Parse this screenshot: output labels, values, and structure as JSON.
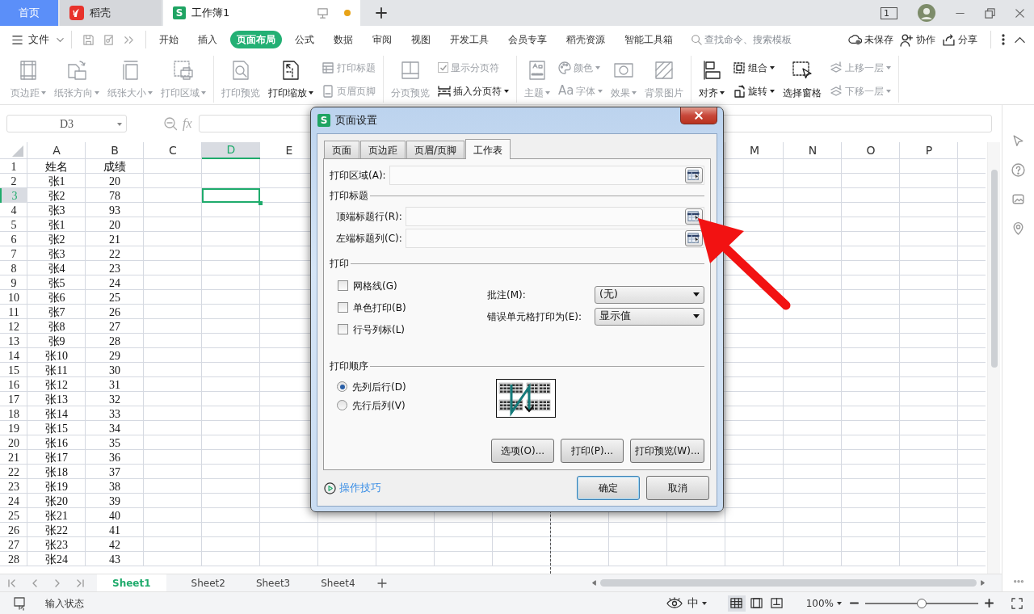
{
  "top_tabs": [
    {
      "kind": "home",
      "label": "首页",
      "selected": false
    },
    {
      "kind": "docer",
      "label": "稻壳",
      "selected": false
    },
    {
      "kind": "sheet",
      "badge": "S",
      "label": "工作簿1",
      "selected": true,
      "unsaved": true
    }
  ],
  "window_count": "1",
  "menu": {
    "file": "文件",
    "tabs": [
      {
        "label": "开始",
        "selected": false
      },
      {
        "label": "插入",
        "selected": false
      },
      {
        "label": "页面布局",
        "selected": true
      },
      {
        "label": "公式",
        "selected": false
      },
      {
        "label": "数据",
        "selected": false
      },
      {
        "label": "审阅",
        "selected": false
      },
      {
        "label": "视图",
        "selected": false
      },
      {
        "label": "开发工具",
        "selected": false
      },
      {
        "label": "会员专享",
        "selected": false
      },
      {
        "label": "稻壳资源",
        "selected": false
      },
      {
        "label": "智能工具箱",
        "selected": false
      }
    ],
    "search_placeholder": "查找命令、搜索模板",
    "actions": [
      "未保存",
      "协作",
      "分享"
    ]
  },
  "ribbon": [
    {
      "items": [
        {
          "kind": "large",
          "label": "页边距",
          "caret": true,
          "disabled": true
        },
        {
          "kind": "large",
          "label": "纸张方向",
          "caret": true,
          "disabled": true
        },
        {
          "kind": "large",
          "label": "纸张大小",
          "caret": true,
          "disabled": true
        },
        {
          "kind": "large",
          "label": "打印区域",
          "caret": true,
          "disabled": true
        }
      ]
    },
    {
      "items": [
        {
          "kind": "large",
          "label": "打印预览",
          "caret": false,
          "disabled": true
        },
        {
          "kind": "large",
          "label": "打印缩放",
          "caret": true,
          "disabled": false
        },
        {
          "kind": "stack",
          "items": [
            {
              "kind": "small",
              "label": "打印标题",
              "caret": false,
              "disabled": true
            },
            {
              "kind": "small",
              "label": "页眉页脚",
              "caret": false,
              "disabled": true
            }
          ]
        }
      ]
    },
    {
      "items": [
        {
          "kind": "large",
          "label": "分页预览",
          "caret": false,
          "disabled": true
        },
        {
          "kind": "stack",
          "items": [
            {
              "kind": "check",
              "label": "显示分页符",
              "checked": true,
              "disabled": true
            },
            {
              "kind": "small",
              "label": "插入分页符",
              "caret": true,
              "disabled": false
            }
          ]
        }
      ]
    },
    {
      "items": [
        {
          "kind": "large",
          "label": "主题",
          "caret": true,
          "disabled": true
        },
        {
          "kind": "stack",
          "items": [
            {
              "kind": "small",
              "label": "颜色",
              "caret": true,
              "disabled": true
            },
            {
              "kind": "small",
              "glyph": "Aa",
              "label": "字体",
              "caret": true,
              "disabled": true
            }
          ]
        },
        {
          "kind": "large",
          "label": "效果",
          "caret": true,
          "disabled": true
        },
        {
          "kind": "large",
          "label": "背景图片",
          "caret": false,
          "disabled": true
        }
      ]
    },
    {
      "items": [
        {
          "kind": "large",
          "label": "对齐",
          "caret": true,
          "disabled": false
        },
        {
          "kind": "stack",
          "items": [
            {
              "kind": "small",
              "label": "组合",
              "caret": true,
              "disabled": false
            },
            {
              "kind": "small",
              "label": "旋转",
              "caret": true,
              "disabled": false
            }
          ]
        },
        {
          "kind": "large",
          "label": "选择窗格",
          "caret": false,
          "disabled": false
        },
        {
          "kind": "stack",
          "items": [
            {
              "kind": "small",
              "label": "上移一层",
              "caret": true,
              "disabled": true
            },
            {
              "kind": "small",
              "label": "下移一层",
              "caret": true,
              "disabled": true
            }
          ]
        }
      ]
    }
  ],
  "name_box": "D3",
  "fx_label": "fx",
  "columns_left": [
    {
      "label": "A",
      "selected": false
    },
    {
      "label": "B",
      "selected": false
    },
    {
      "label": "C",
      "selected": false
    },
    {
      "label": "D",
      "selected": true
    },
    {
      "label": "E",
      "selected": false
    }
  ],
  "columns_right": [
    {
      "label": "M",
      "selected": false
    },
    {
      "label": "N",
      "selected": false
    },
    {
      "label": "O",
      "selected": false
    },
    {
      "label": "P",
      "selected": false
    }
  ],
  "rows": [
    {
      "number": "1",
      "cells": [
        "姓名",
        "成绩"
      ],
      "selected": false
    },
    {
      "number": "2",
      "cells": [
        "张1",
        "20"
      ],
      "selected": false
    },
    {
      "number": "3",
      "cells": [
        "张2",
        "78"
      ],
      "selected": true
    },
    {
      "number": "4",
      "cells": [
        "张3",
        "93"
      ],
      "selected": false
    },
    {
      "number": "5",
      "cells": [
        "张1",
        "20"
      ],
      "selected": false
    },
    {
      "number": "6",
      "cells": [
        "张2",
        "21"
      ],
      "selected": false
    },
    {
      "number": "7",
      "cells": [
        "张3",
        "22"
      ],
      "selected": false
    },
    {
      "number": "8",
      "cells": [
        "张4",
        "23"
      ],
      "selected": false
    },
    {
      "number": "9",
      "cells": [
        "张5",
        "24"
      ],
      "selected": false
    },
    {
      "number": "10",
      "cells": [
        "张6",
        "25"
      ],
      "selected": false
    },
    {
      "number": "11",
      "cells": [
        "张7",
        "26"
      ],
      "selected": false
    },
    {
      "number": "12",
      "cells": [
        "张8",
        "27"
      ],
      "selected": false
    },
    {
      "number": "13",
      "cells": [
        "张9",
        "28"
      ],
      "selected": false
    },
    {
      "number": "14",
      "cells": [
        "张10",
        "29"
      ],
      "selected": false
    },
    {
      "number": "15",
      "cells": [
        "张11",
        "30"
      ],
      "selected": false
    },
    {
      "number": "16",
      "cells": [
        "张12",
        "31"
      ],
      "selected": false
    },
    {
      "number": "17",
      "cells": [
        "张13",
        "32"
      ],
      "selected": false
    },
    {
      "number": "18",
      "cells": [
        "张14",
        "33"
      ],
      "selected": false
    },
    {
      "number": "19",
      "cells": [
        "张15",
        "34"
      ],
      "selected": false
    },
    {
      "number": "20",
      "cells": [
        "张16",
        "35"
      ],
      "selected": false
    },
    {
      "number": "21",
      "cells": [
        "张17",
        "36"
      ],
      "selected": false
    },
    {
      "number": "22",
      "cells": [
        "张18",
        "37"
      ],
      "selected": false
    },
    {
      "number": "23",
      "cells": [
        "张19",
        "38"
      ],
      "selected": false
    },
    {
      "number": "24",
      "cells": [
        "张20",
        "39"
      ],
      "selected": false
    },
    {
      "number": "25",
      "cells": [
        "张21",
        "40"
      ],
      "selected": false
    },
    {
      "number": "26",
      "cells": [
        "张22",
        "41"
      ],
      "selected": false
    },
    {
      "number": "27",
      "cells": [
        "张23",
        "42"
      ],
      "selected": false
    },
    {
      "number": "28",
      "cells": [
        "张24",
        "43"
      ],
      "selected": false
    }
  ],
  "sheets": [
    {
      "label": "Sheet1",
      "selected": true
    },
    {
      "label": "Sheet2",
      "selected": false
    },
    {
      "label": "Sheet3",
      "selected": false
    },
    {
      "label": "Sheet4",
      "selected": false
    }
  ],
  "status": {
    "text": "输入状态",
    "ime": "中",
    "view_modes": [
      {
        "selected": true
      },
      {
        "selected": false
      },
      {
        "selected": false
      }
    ],
    "zoom": "100%",
    "zoom_slider": {
      "level": 0.5
    }
  },
  "dialog": {
    "badge": "S",
    "title": "页面设置",
    "tabs": [
      {
        "label": "页面",
        "selected": false
      },
      {
        "label": "页边距",
        "selected": false
      },
      {
        "label": "页眉/页脚",
        "selected": false
      },
      {
        "label": "工作表",
        "selected": true
      }
    ],
    "print_area": "打印区域(A):",
    "titles_section": "打印标题",
    "title_fields": [
      "顶端标题行(R):",
      "左端标题列(C):"
    ],
    "print_section": "打印",
    "options": [
      {
        "label": "网格线(G)",
        "checked": false
      },
      {
        "label": "单色打印(B)",
        "checked": false
      },
      {
        "label": "行号列标(L)",
        "checked": false
      }
    ],
    "selects": [
      {
        "label": "批注(M):",
        "value": "(无)"
      },
      {
        "label": "错误单元格打印为(E):",
        "value": "显示值"
      }
    ],
    "order_section": "打印顺序",
    "order": [
      {
        "label": "先列后行(D)",
        "selected": true
      },
      {
        "label": "先行后列(V)",
        "selected": false
      }
    ],
    "panel_buttons": [
      "选项(O)...",
      "打印(P)...",
      "打印预览(W)..."
    ],
    "tips_link": "操作技巧",
    "buttons": [
      {
        "label": "确定",
        "default": true
      },
      {
        "label": "取消",
        "default": false
      }
    ]
  }
}
